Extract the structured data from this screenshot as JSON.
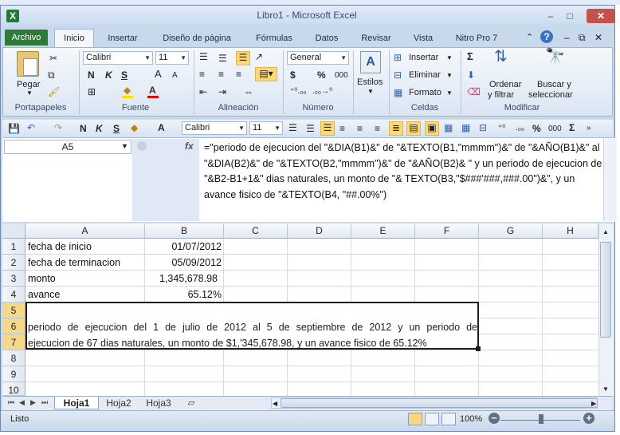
{
  "window": {
    "title": "Libro1 - Microsoft Excel",
    "icon_letter": "X",
    "minimize": "–",
    "maximize": "□",
    "close": "✕",
    "restore": "⧉"
  },
  "ribbon_tabs": [
    "Archivo",
    "Inicio",
    "Insertar",
    "Diseño de página",
    "Fórmulas",
    "Datos",
    "Revisar",
    "Vista",
    "Nitro Pro 7"
  ],
  "ribbon": {
    "portapapeles": {
      "label": "Portapapeles",
      "paste": "Pegar"
    },
    "fuente": {
      "label": "Fuente",
      "font": "Calibri",
      "size": "11",
      "bold": "N",
      "italic": "K",
      "underline": "S",
      "grow": "A",
      "shrink": "A"
    },
    "alineacion": {
      "label": "Alineación"
    },
    "numero": {
      "label": "Número",
      "format": "General",
      "currency": "$",
      "percent": "%",
      "thousands": "000"
    },
    "estilos": {
      "label": "Estilos"
    },
    "celdas": {
      "label": "Celdas",
      "insert": "Insertar",
      "delete": "Eliminar",
      "format": "Formato"
    },
    "modificar": {
      "label": "Modificar",
      "sort": "Ordenar",
      "sort2": "y filtrar",
      "find": "Buscar y",
      "find2": "seleccionar",
      "sum": "Σ"
    }
  },
  "qat": {
    "font": "Calibri",
    "size": "11",
    "bold": "N",
    "italic": "K",
    "underline": "S",
    "percent": "%",
    "thousands": "000",
    "sum": "Σ"
  },
  "formula_bar": {
    "namebox": "A5",
    "fx": "fx",
    "formula": "=\"periodo de ejecucion del \"&DIA(B1)&\" de \"&TEXTO(B1,\"mmmm\")&\" de \"&AÑO(B1)&\" al \"&DIA(B2)&\" de \"&TEXTO(B2,\"mmmm\")&\" de \"&AÑO(B2)& \" y un periodo de ejecucion de \"&B2-B1+1&\" dias naturales, un monto de \"& TEXTO(B3,\"$###'###,###.00\")&\", y un avance fisico de \"&TEXTO(B4, \"##.00%\")"
  },
  "sheet": {
    "columns": [
      "A",
      "B",
      "C",
      "D",
      "E",
      "F",
      "G",
      "H"
    ],
    "rows": [
      "1",
      "2",
      "3",
      "4",
      "5",
      "6",
      "7",
      "8",
      "9",
      "10"
    ],
    "cells": {
      "A1": "fecha de inicio",
      "B1": "01/07/2012",
      "A2": "fecha de terminacion",
      "B2": "05/09/2012",
      "A3": "monto",
      "B3": "1,345,678.98",
      "A4": "avance",
      "B4": "65.12%",
      "merged_line1": "periodo de ejecucion del 1 de julio de 2012 al 5 de septiembre de 2012 y un periodo de",
      "merged_line2": "ejecucion de 67 dias naturales, un monto de $1,'345,678.98, y un avance fisico de 65.12%"
    }
  },
  "sheet_tabs": [
    "Hoja1",
    "Hoja2",
    "Hoja3"
  ],
  "status": {
    "text": "Listo",
    "zoom": "100%"
  }
}
